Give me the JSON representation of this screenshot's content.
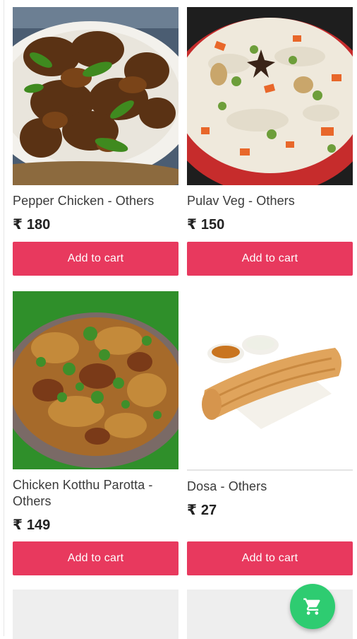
{
  "products": [
    {
      "name": "Pepper Chicken - Others",
      "currency": "₹",
      "price": "180",
      "button_label": "Add to cart",
      "image": "pepper-chicken-image"
    },
    {
      "name": "Pulav Veg - Others",
      "currency": "₹",
      "price": "150",
      "button_label": "Add to cart",
      "image": "pulav-veg-image"
    },
    {
      "name": "Chicken Kotthu Parotta - Others",
      "currency": "₹",
      "price": "149",
      "button_label": "Add to cart",
      "image": "kotthu-parotta-image"
    },
    {
      "name": "Dosa - Others",
      "currency": "₹",
      "price": "27",
      "button_label": "Add to cart",
      "image": "dosa-image"
    }
  ],
  "cart_fab": {
    "icon": "shopping-cart-icon",
    "color": "#2ecc71"
  },
  "colors": {
    "accent": "#e8395e",
    "text": "#333333"
  }
}
